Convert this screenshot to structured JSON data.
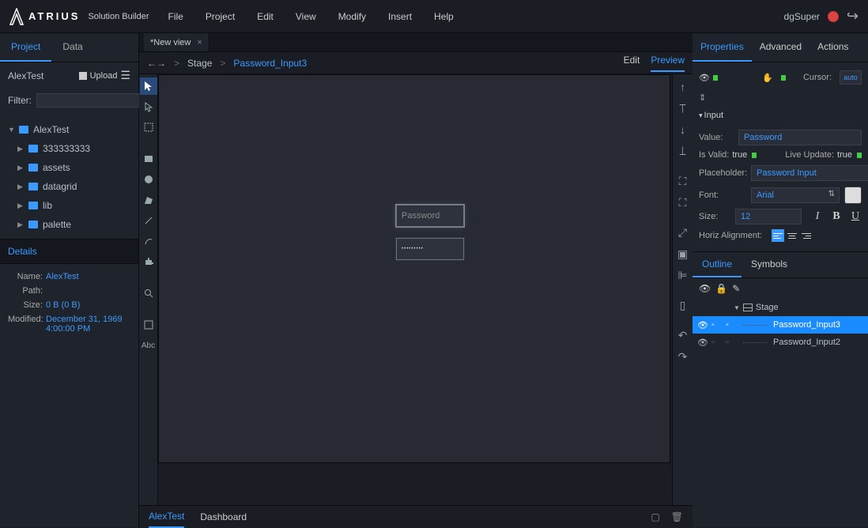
{
  "header": {
    "brand": "ATRIUS",
    "product": "Solution Builder",
    "menu": [
      "File",
      "Project",
      "Edit",
      "View",
      "Modify",
      "Insert",
      "Help"
    ],
    "user": "dgSuper"
  },
  "leftbar": {
    "tabs": {
      "project": "Project",
      "data": "Data"
    },
    "project_name": "AlexTest",
    "upload": "Upload",
    "filter_label": "Filter:",
    "tree": {
      "root": "AlexTest",
      "children": [
        "333333333",
        "assets",
        "datagrid",
        "lib",
        "palette"
      ]
    },
    "details": {
      "title": "Details",
      "name_label": "Name:",
      "name": "AlexTest",
      "path_label": "Path:",
      "path": "",
      "size_label": "Size:",
      "size": "0 B (0 B)",
      "modified_label": "Modified:",
      "modified": "December 31, 1969 4:00:00 PM"
    }
  },
  "center": {
    "doc_tab": "*New view",
    "breadcrumb": {
      "stage": "Stage",
      "current": "Password_Input3"
    },
    "actions": {
      "edit": "Edit",
      "preview": "Preview"
    },
    "inputs": {
      "placeholder1": "Password",
      "value2": "•••••••••"
    },
    "bottom_tabs": {
      "a": "AlexTest",
      "b": "Dashboard"
    }
  },
  "right": {
    "tabs": {
      "properties": "Properties",
      "advanced": "Advanced",
      "actions": "Actions"
    },
    "cursor_label": "Cursor:",
    "cursor_value": "auto",
    "section_input": "Input",
    "value_label": "Value:",
    "value": "Password",
    "isvalid_label": "Is Valid:",
    "isvalid": "true",
    "liveupdate_label": "Live Update:",
    "liveupdate": "true",
    "placeholder_label": "Placeholder:",
    "placeholder": "Password Input",
    "font_label": "Font:",
    "font": "Arial",
    "size_label": "Size:",
    "size": "12",
    "halign_label": "Horiz Alignment:",
    "outline": {
      "tabs": {
        "outline": "Outline",
        "symbols": "Symbols"
      },
      "stage": "Stage",
      "items": [
        "Password_Input3",
        "Password_Input2"
      ]
    }
  }
}
